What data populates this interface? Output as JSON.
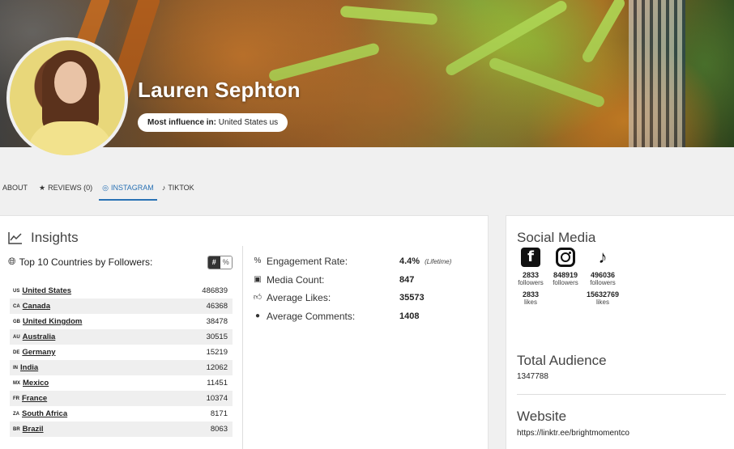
{
  "profile": {
    "name": "Lauren Sephton",
    "influence_label": "Most influence in:",
    "influence_value": "United States us"
  },
  "tabs": [
    {
      "label": "ABOUT",
      "icon": ""
    },
    {
      "label": "REVIEWS (0)",
      "icon": "star-icon"
    },
    {
      "label": "INSTAGRAM",
      "icon": "instagram-icon",
      "active": true
    },
    {
      "label": "TIKTOK",
      "icon": "tiktok-icon"
    }
  ],
  "insights": {
    "title": "Insights",
    "countries_title": "Top 10 Countries by Followers:",
    "toggle": {
      "on": "#",
      "off": "%"
    },
    "countries": [
      {
        "code": "US",
        "name": "United States",
        "value": "486839"
      },
      {
        "code": "CA",
        "name": "Canada",
        "value": "46368"
      },
      {
        "code": "GB",
        "name": "United Kingdom",
        "value": "38478"
      },
      {
        "code": "AU",
        "name": "Australia",
        "value": "30515"
      },
      {
        "code": "DE",
        "name": "Germany",
        "value": "15219"
      },
      {
        "code": "IN",
        "name": "India",
        "value": "12062"
      },
      {
        "code": "MX",
        "name": "Mexico",
        "value": "11451"
      },
      {
        "code": "FR",
        "name": "France",
        "value": "10374"
      },
      {
        "code": "ZA",
        "name": "South Africa",
        "value": "8171"
      },
      {
        "code": "BR",
        "name": "Brazil",
        "value": "8063"
      }
    ],
    "stats": [
      {
        "label": "Engagement Rate:",
        "value": "4.4%",
        "note": "(Lifetime)",
        "icon": "percent-icon"
      },
      {
        "label": "Media Count:",
        "value": "847",
        "note": "",
        "icon": "media-icon"
      },
      {
        "label": "Average Likes:",
        "value": "35573",
        "note": "",
        "icon": "thumbs-up-icon"
      },
      {
        "label": "Average Comments:",
        "value": "1408",
        "note": "",
        "icon": "comment-icon"
      }
    ]
  },
  "social": {
    "title": "Social Media",
    "networks": [
      {
        "name": "facebook",
        "followers": "2833",
        "followers_label": "followers",
        "likes": "2833",
        "likes_label": "likes"
      },
      {
        "name": "instagram",
        "followers": "848919",
        "followers_label": "followers",
        "likes": "",
        "likes_label": ""
      },
      {
        "name": "tiktok",
        "followers": "496036",
        "followers_label": "followers",
        "likes": "15632769",
        "likes_label": "likes"
      }
    ],
    "total_audience_title": "Total Audience",
    "total_audience": "1347788",
    "website_title": "Website",
    "website": "https://linktr.ee/brightmomentco"
  },
  "colors": {
    "accent": "#2a72b5"
  }
}
